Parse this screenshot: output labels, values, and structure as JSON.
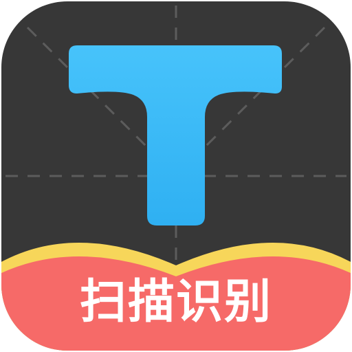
{
  "app_icon": {
    "label": "扫描识别",
    "glyph_icon": "text-T-icon",
    "colors": {
      "background": "#373737",
      "grid_lines": "#5a5a5a",
      "letter": "#35b6f5",
      "book_page_edge": "#f7d65a",
      "book_cover": "#f66a68",
      "label_text": "#ffffff"
    }
  }
}
